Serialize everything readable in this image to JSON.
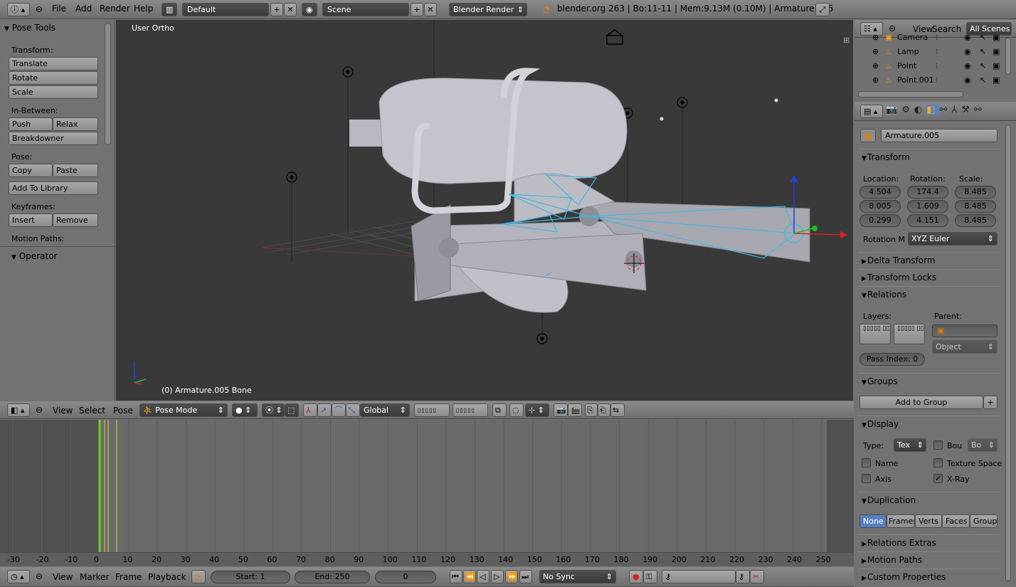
{
  "top_header": {
    "menu": [
      "File",
      "Add",
      "Render",
      "Help"
    ],
    "screen_layout": "Default",
    "scene": "Scene",
    "render_engine": "Blender Render",
    "status": "blender.org 263 | Bo:11-11  | Mem:9.13M (0.10M) | Armature.005"
  },
  "toolshelf": {
    "title": "Pose Tools",
    "transform_label": "Transform:",
    "translate": "Translate",
    "rotate": "Rotate",
    "scale": "Scale",
    "inbetween_label": "In-Between:",
    "push": "Push",
    "relax": "Relax",
    "breakdowner": "Breakdowner",
    "pose_label": "Pose:",
    "copy": "Copy",
    "paste": "Paste",
    "add_to_library": "Add To Library",
    "keyframes_label": "Keyframes:",
    "insert": "Insert",
    "remove": "Remove",
    "motion_paths_label": "Motion Paths:",
    "operator": "Operator"
  },
  "viewport": {
    "view_name": "User Ortho",
    "object_info": "(0) Armature.005 Bone"
  },
  "view3d_header": {
    "view": "View",
    "select": "Select",
    "pose": "Pose",
    "mode": "Pose Mode",
    "orientation": "Global"
  },
  "timeline": {
    "ticks": [
      "-30",
      "-20",
      "-10",
      "0",
      "10",
      "20",
      "30",
      "40",
      "50",
      "60",
      "70",
      "80",
      "90",
      "100",
      "110",
      "120",
      "130",
      "140",
      "150",
      "160",
      "170",
      "180",
      "190",
      "200",
      "210",
      "220",
      "230",
      "240",
      "250"
    ],
    "view": "View",
    "marker": "Marker",
    "frame": "Frame",
    "playback": "Playback",
    "start": "Start: 1",
    "end": "End: 250",
    "current": "0",
    "sync": "No Sync"
  },
  "outliner": {
    "view": "View",
    "search": "Search",
    "filter": "All Scenes",
    "items": [
      "Camera",
      "Lamp",
      "Point",
      "Point.001"
    ]
  },
  "properties": {
    "object_name": "Armature.005",
    "transform": "Transform",
    "location_label": "Location:",
    "rotation_label": "Rotation:",
    "scale_label": "Scale:",
    "location": [
      "4.504",
      "8.005",
      "0.299"
    ],
    "rotation": [
      "174.4",
      "1.609",
      "4.151"
    ],
    "scale": [
      "8.485",
      "8.485",
      "8.485"
    ],
    "rotation_mode_label": "Rotation M",
    "rotation_mode": "XYZ Euler",
    "delta_transform": "Delta Transform",
    "transform_locks": "Transform Locks",
    "relations": "Relations",
    "layers_label": "Layers:",
    "parent_label": "Parent:",
    "parent_type": "Object",
    "pass_index": "Pass Index: 0",
    "groups": "Groups",
    "add_to_group": "Add to Group",
    "display": "Display",
    "type_label": "Type:",
    "type_value": "Tex",
    "bounds_label": "Bou",
    "bounds_value": "Bo",
    "name_label": "Name",
    "texture_space_label": "Texture Space",
    "axis_label": "Axis",
    "xray_label": "X-Ray",
    "duplication": "Duplication",
    "dup_options": [
      "None",
      "Frames",
      "Verts",
      "Faces",
      "Group"
    ],
    "relations_extras": "Relations Extras",
    "motion_paths": "Motion Paths",
    "custom_properties": "Custom Properties"
  }
}
